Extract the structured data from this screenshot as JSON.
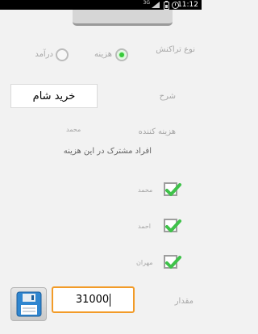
{
  "status_bar": {
    "time": "11:12",
    "network": "3G"
  },
  "form": {
    "transaction_type_label": "نوع تراکنش",
    "options": [
      {
        "label": "هزینه",
        "selected": true
      },
      {
        "label": "درآمد",
        "selected": false
      }
    ],
    "description_label": "شرح",
    "description_value": "خرید شام",
    "payer_label": "هزینه کننده",
    "payer_value": "محمد",
    "participants_heading": "افراد مشترک در این هزینه",
    "participants": [
      {
        "name": "محمد",
        "checked": true
      },
      {
        "name": "احمد",
        "checked": true
      },
      {
        "name": "مهران",
        "checked": true
      }
    ],
    "amount_label": "مقدار",
    "amount_value": "31000"
  },
  "colors": {
    "check_green": "#3fc24a",
    "focus_orange": "#f29b28",
    "save_icon_blue": "#2f86d0"
  },
  "icons": {
    "save": "floppy-disk-icon",
    "check": "checkmark-icon"
  }
}
